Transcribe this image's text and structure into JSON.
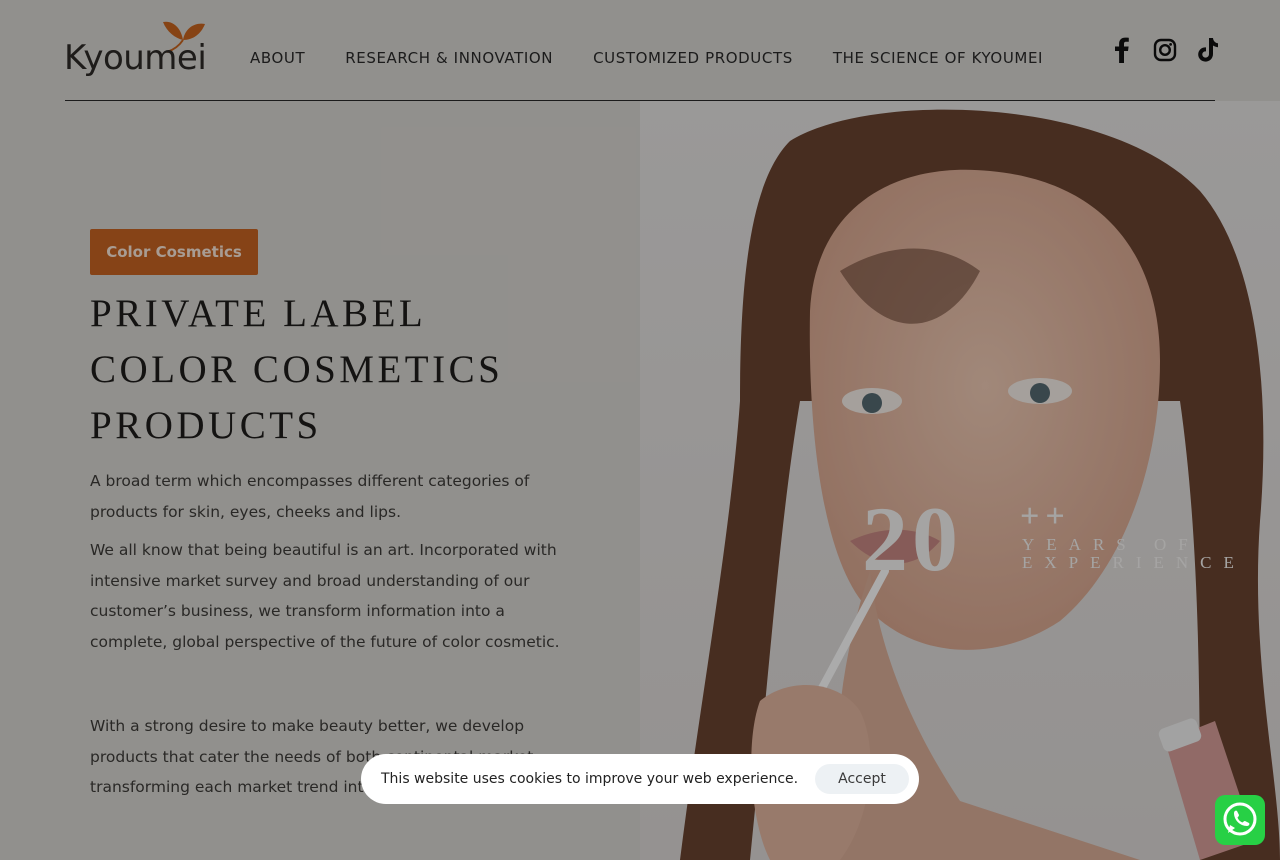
{
  "header": {
    "logo_text": "Kyoumei",
    "nav": [
      "ABOUT",
      "RESEARCH & INNOVATION",
      "CUSTOMIZED PRODUCTS",
      "THE SCIENCE OF KYOUMEI"
    ],
    "social": [
      "facebook-icon",
      "instagram-icon",
      "tiktok-icon"
    ]
  },
  "hero": {
    "badge": "Color Cosmetics",
    "headline_lines": [
      "PRIVATE LABEL",
      "COLOR COSMETICS",
      "PRODUCTS"
    ],
    "paragraph_1": "A broad term which encompasses different categories of products for skin, eyes, cheeks and lips.",
    "paragraph_2": "We all know that being beautiful is an art. Incorporated with intensive market survey and broad understanding of our customer’s business, we transform information into a complete, global perspective of the future of color cosmetic.",
    "paragraph_3": "With a strong desire to make beauty better, we develop products that cater the needs of both continental market, transforming each market trend into reality."
  },
  "stat": {
    "number": "20",
    "plus": "++",
    "label": "YEARS OF EXPERIENCE"
  },
  "cookie": {
    "message": "This website uses cookies to improve your web experience.",
    "accept_label": "Accept"
  },
  "colors": {
    "accent": "#c86423",
    "whatsapp": "#27d045"
  }
}
